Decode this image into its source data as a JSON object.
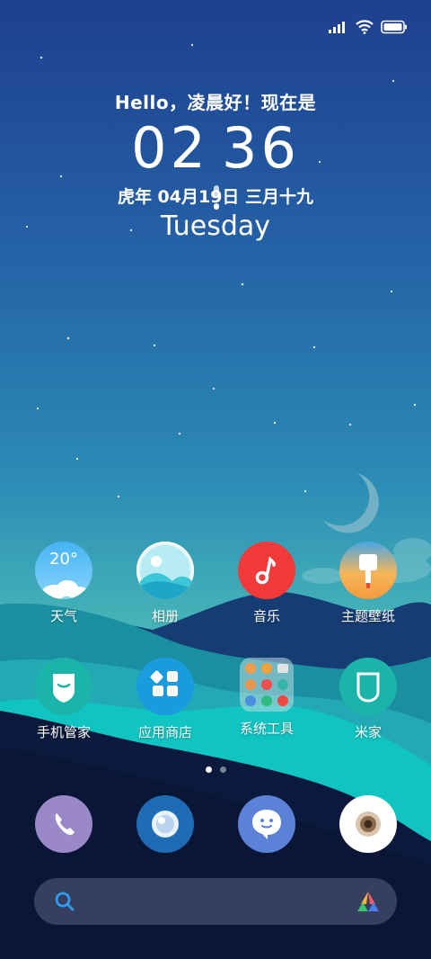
{
  "status_bar": {
    "signal_icon": "signal-bars-icon",
    "wifi_icon": "wifi-icon",
    "battery_icon": "battery-full-icon"
  },
  "clock_widget": {
    "greeting": "Hello，凌晨好！现在是",
    "hours": "02",
    "minutes": "36",
    "date_line": "虎年 04月19日 三月十九",
    "weekday": "Tuesday"
  },
  "apps_row1": [
    {
      "label": "天气",
      "icon": "weather-icon",
      "temp": "20°"
    },
    {
      "label": "相册",
      "icon": "gallery-icon"
    },
    {
      "label": "音乐",
      "icon": "music-note-icon"
    },
    {
      "label": "主题壁纸",
      "icon": "theme-brush-icon"
    }
  ],
  "apps_row2": [
    {
      "label": "手机管家",
      "icon": "security-shield-icon"
    },
    {
      "label": "应用商店",
      "icon": "app-store-icon"
    },
    {
      "label": "系统工具",
      "icon": "tools-folder-icon"
    },
    {
      "label": "米家",
      "icon": "mijia-icon"
    }
  ],
  "pager": {
    "pages": 2,
    "current": 1
  },
  "dock": [
    {
      "name": "phone",
      "icon": "phone-icon"
    },
    {
      "name": "browser",
      "icon": "browser-icon"
    },
    {
      "name": "messages",
      "icon": "messages-icon"
    },
    {
      "name": "camera",
      "icon": "camera-icon"
    }
  ],
  "search_bar": {
    "search_icon": "search-icon",
    "assistant_icon": "assistant-icon"
  },
  "colors": {
    "music_red": "#f23a3a",
    "dock_phone": "#9b88c8",
    "dock_browser": "#1f6bb6",
    "dock_messages": "#5b82d6"
  }
}
